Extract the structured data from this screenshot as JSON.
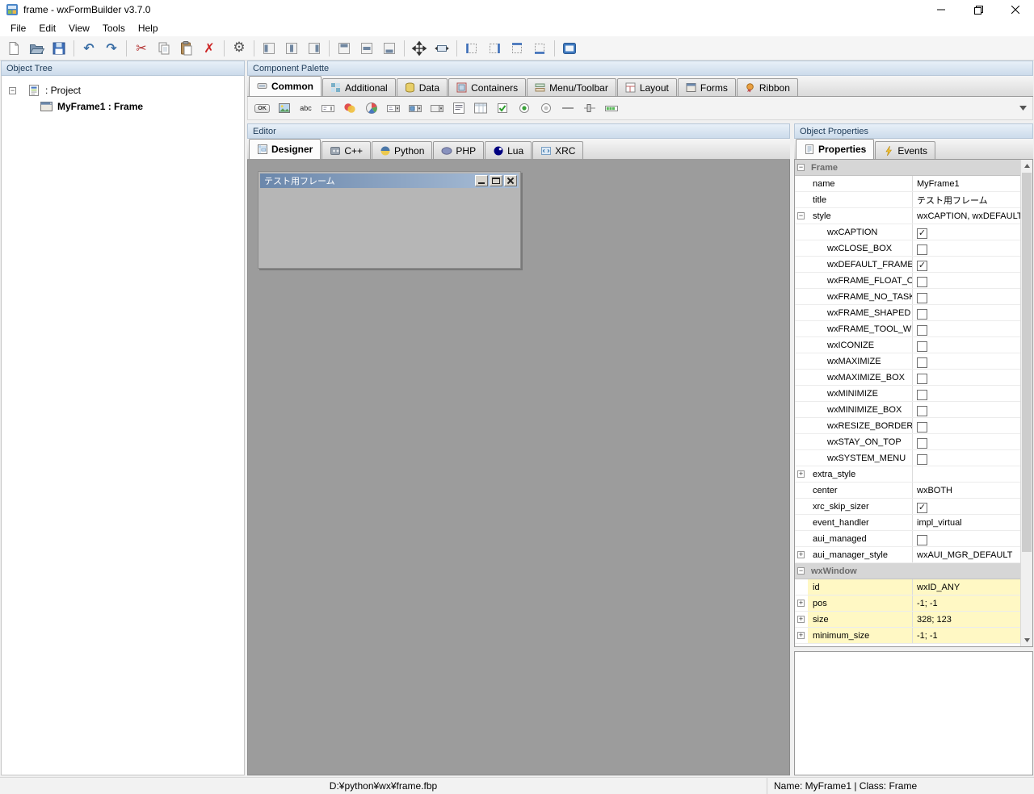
{
  "window": {
    "title": "frame - wxFormBuilder v3.7.0",
    "controls": [
      "minimize-button",
      "maximize-restore-button",
      "close-button"
    ]
  },
  "menubar": {
    "items": [
      "File",
      "Edit",
      "View",
      "Tools",
      "Help"
    ]
  },
  "toolbar": {
    "items": [
      {
        "name": "new-project-button",
        "kind": "new"
      },
      {
        "name": "open-project-button",
        "kind": "open"
      },
      {
        "name": "save-project-button",
        "kind": "save"
      },
      {
        "sep": true
      },
      {
        "name": "undo-button",
        "kind": "undo"
      },
      {
        "name": "redo-button",
        "kind": "redo"
      },
      {
        "sep": true
      },
      {
        "name": "cut-button",
        "kind": "cut"
      },
      {
        "name": "copy-button",
        "kind": "copy"
      },
      {
        "name": "paste-button",
        "kind": "paste"
      },
      {
        "name": "delete-button",
        "kind": "delete"
      },
      {
        "sep": true
      },
      {
        "name": "generate-code-button",
        "kind": "gear"
      },
      {
        "sep": true
      },
      {
        "name": "align-left-button",
        "kind": "align-left"
      },
      {
        "name": "align-center-horizontal-button",
        "kind": "align-center-h"
      },
      {
        "name": "align-right-button",
        "kind": "align-right"
      },
      {
        "sep": true
      },
      {
        "name": "align-top-button",
        "kind": "align-top"
      },
      {
        "name": "align-center-vertical-button",
        "kind": "align-center-v"
      },
      {
        "name": "align-bottom-button",
        "kind": "align-bottom"
      },
      {
        "sep": true
      },
      {
        "name": "expand-button",
        "kind": "expand"
      },
      {
        "name": "stretch-button",
        "kind": "stretch"
      },
      {
        "sep": true
      },
      {
        "name": "border-left-button",
        "kind": "border-left"
      },
      {
        "name": "border-right-button",
        "kind": "border-right"
      },
      {
        "name": "border-top-button",
        "kind": "border-top"
      },
      {
        "name": "border-bottom-button",
        "kind": "border-bottom"
      },
      {
        "sep": true
      },
      {
        "name": "default-editor-button",
        "kind": "blue-editor"
      }
    ]
  },
  "object_tree": {
    "header": "Object Tree",
    "items": [
      {
        "label": ": Project",
        "icon": "project",
        "level": 0,
        "expand": "minus",
        "bold": false
      },
      {
        "label": "MyFrame1 : Frame",
        "icon": "frame",
        "level": 1,
        "bold": true
      }
    ]
  },
  "palette": {
    "header": "Component Palette",
    "tabs": [
      {
        "label": "Common",
        "icon": "common",
        "active": true
      },
      {
        "label": "Additional",
        "icon": "additional",
        "active": false
      },
      {
        "label": "Data",
        "icon": "data",
        "active": false
      },
      {
        "label": "Containers",
        "icon": "containers",
        "active": false
      },
      {
        "label": "Menu/Toolbar",
        "icon": "menu-toolbar",
        "active": false
      },
      {
        "label": "Layout",
        "icon": "layout",
        "active": false
      },
      {
        "label": "Forms",
        "icon": "forms",
        "active": false
      },
      {
        "label": "Ribbon",
        "icon": "ribbon",
        "active": false
      }
    ],
    "tools": [
      {
        "name": "palette-wxbutton-tool",
        "kind": "ok",
        "glyph": "OK"
      },
      {
        "name": "palette-wxbitmapbutton-tool",
        "kind": "img"
      },
      {
        "name": "palette-wxstatictext-tool",
        "kind": "abc",
        "glyph": "abc"
      },
      {
        "name": "palette-wxtextctrl-tool",
        "kind": "textctrl"
      },
      {
        "name": "palette-wxstaticbitmap-tool",
        "kind": "blob"
      },
      {
        "name": "palette-wxanimationctrl-tool",
        "kind": "anim"
      },
      {
        "name": "palette-wxcombobox-tool",
        "kind": "combo"
      },
      {
        "name": "palette-wxbitmapcombobox-tool",
        "kind": "combo2"
      },
      {
        "name": "palette-wxchoice-tool",
        "kind": "choice"
      },
      {
        "name": "palette-wxlistbox-tool",
        "kind": "list"
      },
      {
        "name": "palette-wxlistctrl-tool",
        "kind": "report"
      },
      {
        "name": "palette-wxcheckbox-tool",
        "kind": "check"
      },
      {
        "name": "palette-wxradiobutton-tool",
        "kind": "radio-on"
      },
      {
        "name": "palette-wxtogglebutton-tool",
        "kind": "radio-off"
      },
      {
        "name": "palette-wxstaticline-tool",
        "kind": "hline"
      },
      {
        "name": "palette-wxslider-tool",
        "kind": "slider"
      },
      {
        "name": "palette-wxgauge-tool",
        "kind": "gauge"
      }
    ],
    "overflow_icon": "chevron-down-icon"
  },
  "editor": {
    "header": "Editor",
    "tabs": [
      {
        "label": "Designer",
        "icon": "designer",
        "active": true
      },
      {
        "label": "C++",
        "icon": "cpp",
        "active": false
      },
      {
        "label": "Python",
        "icon": "python",
        "active": false
      },
      {
        "label": "PHP",
        "icon": "php",
        "active": false
      },
      {
        "label": "Lua",
        "icon": "lua",
        "active": false
      },
      {
        "label": "XRC",
        "icon": "xrc",
        "active": false
      }
    ],
    "preview": {
      "title": "テスト用フレーム"
    }
  },
  "properties": {
    "header": "Object Properties",
    "tabs": [
      {
        "label": "Properties",
        "icon": "properties",
        "active": true
      },
      {
        "label": "Events",
        "icon": "events",
        "active": false
      }
    ],
    "rows": [
      {
        "type": "category",
        "label": "Frame",
        "expand": "minus"
      },
      {
        "type": "text",
        "label": "name",
        "value": "MyFrame1"
      },
      {
        "type": "text",
        "label": "title",
        "value": "テスト用フレーム"
      },
      {
        "type": "text",
        "label": "style",
        "value": "wxCAPTION, wxDEFAULT_FRAME_STYLE",
        "expand": "minus"
      },
      {
        "type": "check",
        "label": "wxCAPTION",
        "checked": true,
        "indent": 1
      },
      {
        "type": "check",
        "label": "wxCLOSE_BOX",
        "checked": false,
        "indent": 1
      },
      {
        "type": "check",
        "label": "wxDEFAULT_FRAME_STYLE",
        "checked": true,
        "indent": 1
      },
      {
        "type": "check",
        "label": "wxFRAME_FLOAT_ON_PARENT",
        "checked": false,
        "indent": 1
      },
      {
        "type": "check",
        "label": "wxFRAME_NO_TASKBAR",
        "checked": false,
        "indent": 1
      },
      {
        "type": "check",
        "label": "wxFRAME_SHAPED",
        "checked": false,
        "indent": 1
      },
      {
        "type": "check",
        "label": "wxFRAME_TOOL_WINDOW",
        "checked": false,
        "indent": 1
      },
      {
        "type": "check",
        "label": "wxICONIZE",
        "checked": false,
        "indent": 1
      },
      {
        "type": "check",
        "label": "wxMAXIMIZE",
        "checked": false,
        "indent": 1
      },
      {
        "type": "check",
        "label": "wxMAXIMIZE_BOX",
        "checked": false,
        "indent": 1
      },
      {
        "type": "check",
        "label": "wxMINIMIZE",
        "checked": false,
        "indent": 1
      },
      {
        "type": "check",
        "label": "wxMINIMIZE_BOX",
        "checked": false,
        "indent": 1
      },
      {
        "type": "check",
        "label": "wxRESIZE_BORDER",
        "checked": false,
        "indent": 1
      },
      {
        "type": "check",
        "label": "wxSTAY_ON_TOP",
        "checked": false,
        "indent": 1
      },
      {
        "type": "check",
        "label": "wxSYSTEM_MENU",
        "checked": false,
        "indent": 1
      },
      {
        "type": "text",
        "label": "extra_style",
        "value": "",
        "expand": "plus"
      },
      {
        "type": "text",
        "label": "center",
        "value": "wxBOTH"
      },
      {
        "type": "check",
        "label": "xrc_skip_sizer",
        "checked": true
      },
      {
        "type": "text",
        "label": "event_handler",
        "value": "impl_virtual"
      },
      {
        "type": "check",
        "label": "aui_managed",
        "checked": false
      },
      {
        "type": "text",
        "label": "aui_manager_style",
        "value": "wxAUI_MGR_DEFAULT",
        "expand": "plus"
      },
      {
        "type": "category",
        "label": "wxWindow",
        "expand": "minus"
      },
      {
        "type": "text",
        "label": "id",
        "value": "wxID_ANY",
        "yellow": true
      },
      {
        "type": "text",
        "label": "pos",
        "value": "-1; -1",
        "expand": "plus",
        "yellow": true
      },
      {
        "type": "text",
        "label": "size",
        "value": "328; 123",
        "expand": "plus",
        "yellow": true
      },
      {
        "type": "text",
        "label": "minimum_size",
        "value": "-1; -1",
        "expand": "plus",
        "yellow": true
      }
    ]
  },
  "statusbar": {
    "path": "D:¥python¥wx¥frame.fbp",
    "selection": "Name: MyFrame1 | Class: Frame"
  },
  "colors": {
    "accent_blue": "#3b6db8",
    "panel_header_top": "#e8f0f8",
    "panel_header_bottom": "#ccdbeb",
    "panel_header_text": "#1e3b58",
    "canvas_gray": "#9c9c9c",
    "caption_gradient_left": "#6b87ab",
    "caption_gradient_right": "#aabfd8",
    "grid_yellow": "#fff8c4",
    "category_bg": "#d6d6d6",
    "tab_active_bg": "#fcfcfc"
  }
}
